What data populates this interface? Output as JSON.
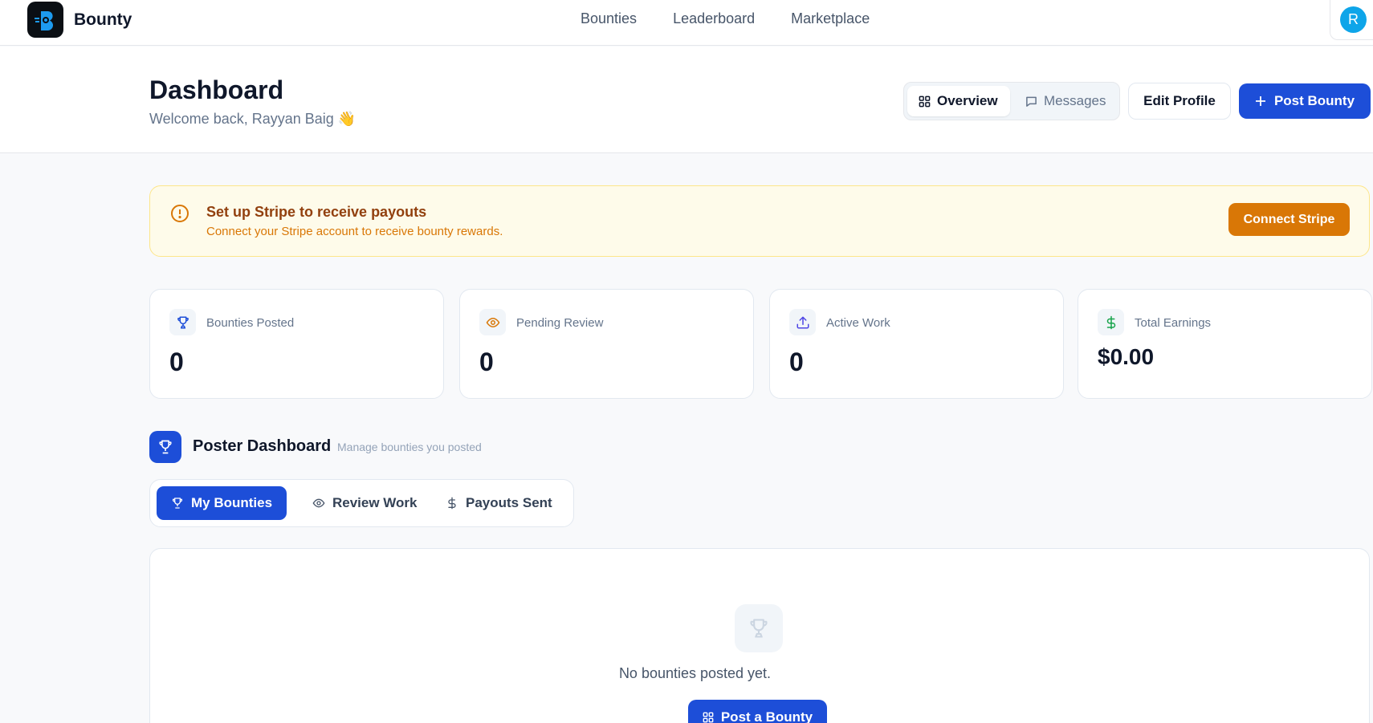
{
  "brand": {
    "name": "Bounty",
    "logo_icon": "bounty-logo-icon"
  },
  "nav": {
    "links": [
      "Bounties",
      "Leaderboard",
      "Marketplace"
    ],
    "avatar_initial": "R"
  },
  "header": {
    "title": "Dashboard",
    "welcome": "Welcome back, Rayyan Baig 👋",
    "segments": {
      "overview": "Overview",
      "messages": "Messages"
    },
    "edit_profile": "Edit Profile",
    "post_bounty": "Post Bounty"
  },
  "banner": {
    "title": "Set up Stripe to receive payouts",
    "subtitle": "Connect your Stripe account to receive bounty rewards.",
    "button": "Connect Stripe",
    "icon": "alert-circle-icon"
  },
  "stats": [
    {
      "label": "Bounties Posted",
      "value": "0",
      "icon": "trophy-icon",
      "color": "#1d4ed8"
    },
    {
      "label": "Pending Review",
      "value": "0",
      "icon": "eye-icon",
      "color": "#d97706"
    },
    {
      "label": "Active Work",
      "value": "0",
      "icon": "upload-icon",
      "color": "#4f46e5"
    },
    {
      "label": "Total Earnings",
      "value": "$0.00",
      "icon": "dollar-icon",
      "color": "#16a34a"
    }
  ],
  "poster": {
    "title": "Poster Dashboard",
    "subtitle": "Manage bounties you posted",
    "tabs": [
      "My Bounties",
      "Review Work",
      "Payouts Sent"
    ]
  },
  "empty": {
    "text": "No bounties posted yet.",
    "button": "Post a Bounty"
  },
  "colors": {
    "primary": "#1d4ed8",
    "warning": "#d97706",
    "avatar": "#0ea5e9"
  }
}
